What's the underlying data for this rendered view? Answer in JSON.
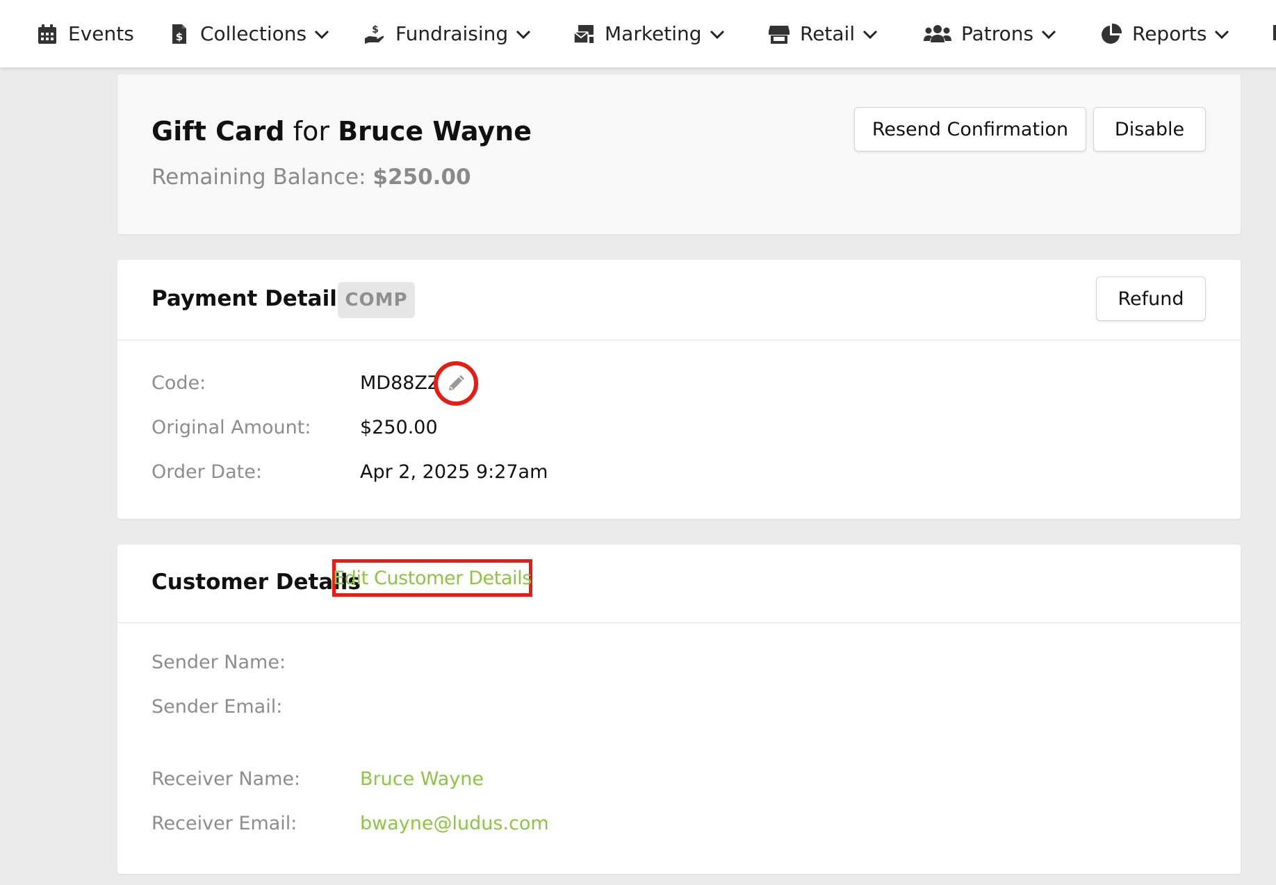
{
  "nav": {
    "items": [
      {
        "label": "Events",
        "icon": "calendar-icon",
        "dropdown": false
      },
      {
        "label": "Collections",
        "icon": "money-file-icon",
        "dropdown": true
      },
      {
        "label": "Fundraising",
        "icon": "donate-hand-icon",
        "dropdown": true
      },
      {
        "label": "Marketing",
        "icon": "mail-bulk-icon",
        "dropdown": true
      },
      {
        "label": "Retail",
        "icon": "store-icon",
        "dropdown": true
      },
      {
        "label": "Patrons",
        "icon": "users-icon",
        "dropdown": true
      },
      {
        "label": "Reports",
        "icon": "pie-chart-icon",
        "dropdown": true
      }
    ]
  },
  "header": {
    "type": "Gift Card",
    "connector": "for",
    "recipient": "Bruce Wayne",
    "balance_label": "Remaining Balance:",
    "balance_value": "$250.00",
    "resend_label": "Resend Confirmation",
    "disable_label": "Disable"
  },
  "payment": {
    "title": "Payment Details",
    "badge": "COMP",
    "refund_label": "Refund",
    "rows": [
      {
        "label": "Code:",
        "value": "MD88ZZ"
      },
      {
        "label": "Original Amount:",
        "value": "$250.00"
      },
      {
        "label": "Order Date:",
        "value": "Apr 2, 2025 9:27am"
      }
    ]
  },
  "customer": {
    "title": "Customer Details",
    "edit_label": "Edit Customer Details",
    "rows": [
      {
        "label": "Sender Name:",
        "value": ""
      },
      {
        "label": "Sender Email:",
        "value": ""
      },
      {
        "label": "Receiver Name:",
        "value": "Bruce Wayne"
      },
      {
        "label": "Receiver Email:",
        "value": "bwayne@ludus.com"
      }
    ]
  },
  "colors": {
    "accent_green": "#8cc63f",
    "highlight_red": "#e81c12",
    "label_gray": "#8c8c8c"
  }
}
